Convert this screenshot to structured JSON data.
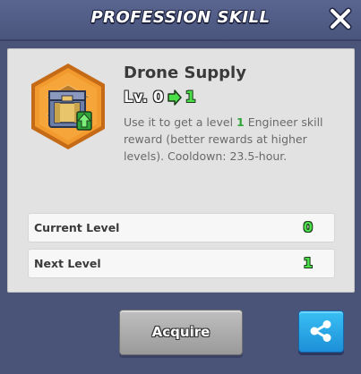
{
  "header": {
    "title": "PROFESSION SKILL"
  },
  "skill": {
    "name": "Drone Supply",
    "level_prefix": "Lv. 0",
    "level_next": "1",
    "description_before": "Use it to get a level ",
    "description_highlight": "1",
    "description_after": " Engineer skill reward (better rewards at higher levels). Cooldown: 23.5-hour.",
    "icon": "supply-crate-icon"
  },
  "levels": [
    {
      "label": "Current Level",
      "value": "0"
    },
    {
      "label": "Next Level",
      "value": "1"
    }
  ],
  "actions": {
    "acquire_label": "Acquire",
    "share_icon": "share-icon",
    "close_icon": "close-icon"
  },
  "colors": {
    "background": "#4a5478",
    "panel": "#e2e2e2",
    "highlight_green": "#4be04a",
    "share_blue": "#1d8fd8",
    "icon_orange": "#f28a1e"
  }
}
